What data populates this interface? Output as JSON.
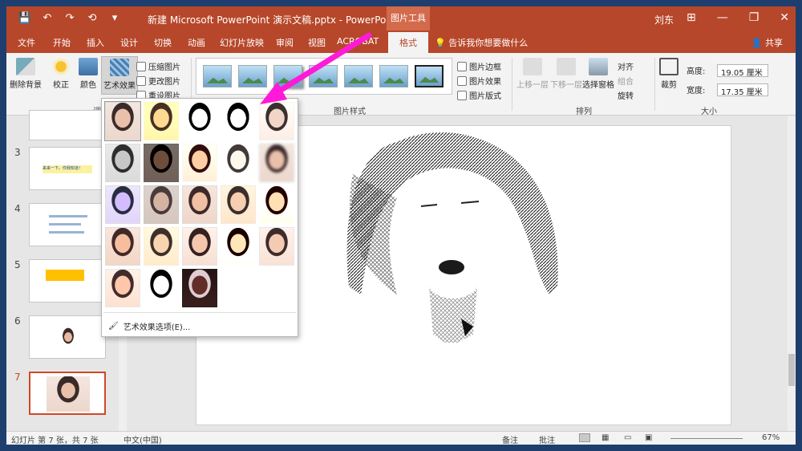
{
  "window": {
    "doc_title": "新建 Microsoft PowerPoint 演示文稿.pptx  -  PowerPoint",
    "context_tools": "图片工具",
    "user": "刘东",
    "controls": [
      "⊞",
      "—",
      "❐",
      "✕"
    ]
  },
  "qat": [
    "💾",
    "↶",
    "↷",
    "⟲",
    "▾"
  ],
  "tabs": [
    "文件",
    "开始",
    "插入",
    "设计",
    "切换",
    "动画",
    "幻灯片放映",
    "审阅",
    "视图",
    "ACROBAT",
    "格式"
  ],
  "tellme": "告诉我你想要做什么",
  "share": "共享",
  "ribbon": {
    "remove_bg": "删除背景",
    "corrections": "校正",
    "color": "颜色",
    "artistic": "艺术效果",
    "compress": "压缩图片",
    "change": "更改图片",
    "reset": "重设图片",
    "adjust_label": "调",
    "styles_label": "图片样式",
    "border": "图片边框",
    "effects": "图片效果",
    "layout": "图片版式",
    "bring_fwd": "上移一层",
    "send_back": "下移一层",
    "selection": "选择窗格",
    "align": "对齐",
    "group": "组合",
    "rotate": "旋转",
    "arrange_label": "排列",
    "crop": "裁剪",
    "height_label": "高度:",
    "height_val": "19.05 厘米",
    "width_label": "宽度:",
    "width_val": "17.35 厘米",
    "size_label": "大小"
  },
  "slides": [
    {
      "num": "3",
      "text": "来来一下。你我知道！"
    },
    {
      "num": "4",
      "text": ""
    },
    {
      "num": "5",
      "text": ""
    },
    {
      "num": "6",
      "text": ""
    },
    {
      "num": "7",
      "text": ""
    }
  ],
  "dropdown": {
    "option": "艺术效果选项(E)..."
  },
  "status": {
    "slide_info": "幻灯片 第 7 张，共 7 张",
    "lang": "中文(中国)",
    "notes": "备注",
    "comments": "批注",
    "zoom": "67%"
  },
  "colors": {
    "accent": "#b7472a",
    "arrow": "#ff1ad9"
  }
}
